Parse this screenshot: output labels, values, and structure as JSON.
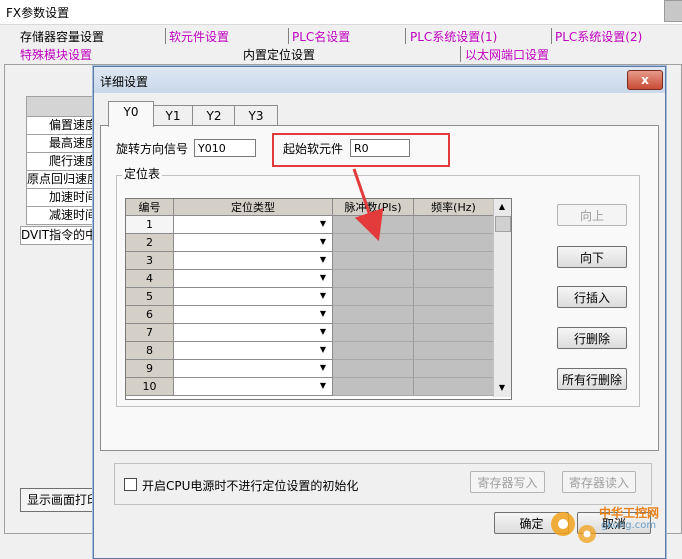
{
  "outer_window": {
    "title": "FX参数设置",
    "tabs_row1": [
      "存储器容量设置",
      "软元件设置",
      "PLC名设置",
      "PLC系统设置(1)",
      "PLC系统设置(2)"
    ],
    "tabs_row2": [
      "特殊模块设置",
      "内置定位设置",
      "以太网端口设置"
    ],
    "left_rows": [
      "偏置速度",
      "最高速度",
      "爬行速度",
      "原点回归速度",
      "加速时间",
      "减速时间",
      "DVIT指令的中断输入"
    ],
    "display_print_button": "显示画面打印"
  },
  "dialog": {
    "title": "详细设置",
    "close_glyph": "x",
    "tabs": [
      "Y0",
      "Y1",
      "Y2",
      "Y3"
    ],
    "active_tab": "Y0",
    "rotation_signal_label": "旋转方向信号",
    "rotation_signal_value": "Y010",
    "start_device_label": "起始软元件",
    "start_device_value": "R0",
    "group_title": "定位表",
    "columns": [
      "编号",
      "定位类型",
      "脉冲数(Pls)",
      "频率(Hz)"
    ],
    "rows": [
      "1",
      "2",
      "3",
      "4",
      "5",
      "6",
      "7",
      "8",
      "9",
      "10"
    ],
    "buttons": {
      "move_up": "向上",
      "move_down": "向下",
      "insert_row": "行插入",
      "delete_row": "行删除",
      "delete_all_rows": "所有行删除"
    },
    "init_checkbox_label": "开启CPU电源时不进行定位设置的初始化",
    "register_write": "寄存器写入",
    "register_read": "寄存器读入",
    "ok_button": "确定",
    "cancel_button": "取消"
  },
  "watermark": {
    "text": "中华工控网",
    "subtext": "gkong.com"
  },
  "colors": {
    "highlight_box": "#e33b3b",
    "arrow": "#e33b3b",
    "tab_magenta": "#c000c0",
    "grid_grey": "#c0c0c0"
  }
}
